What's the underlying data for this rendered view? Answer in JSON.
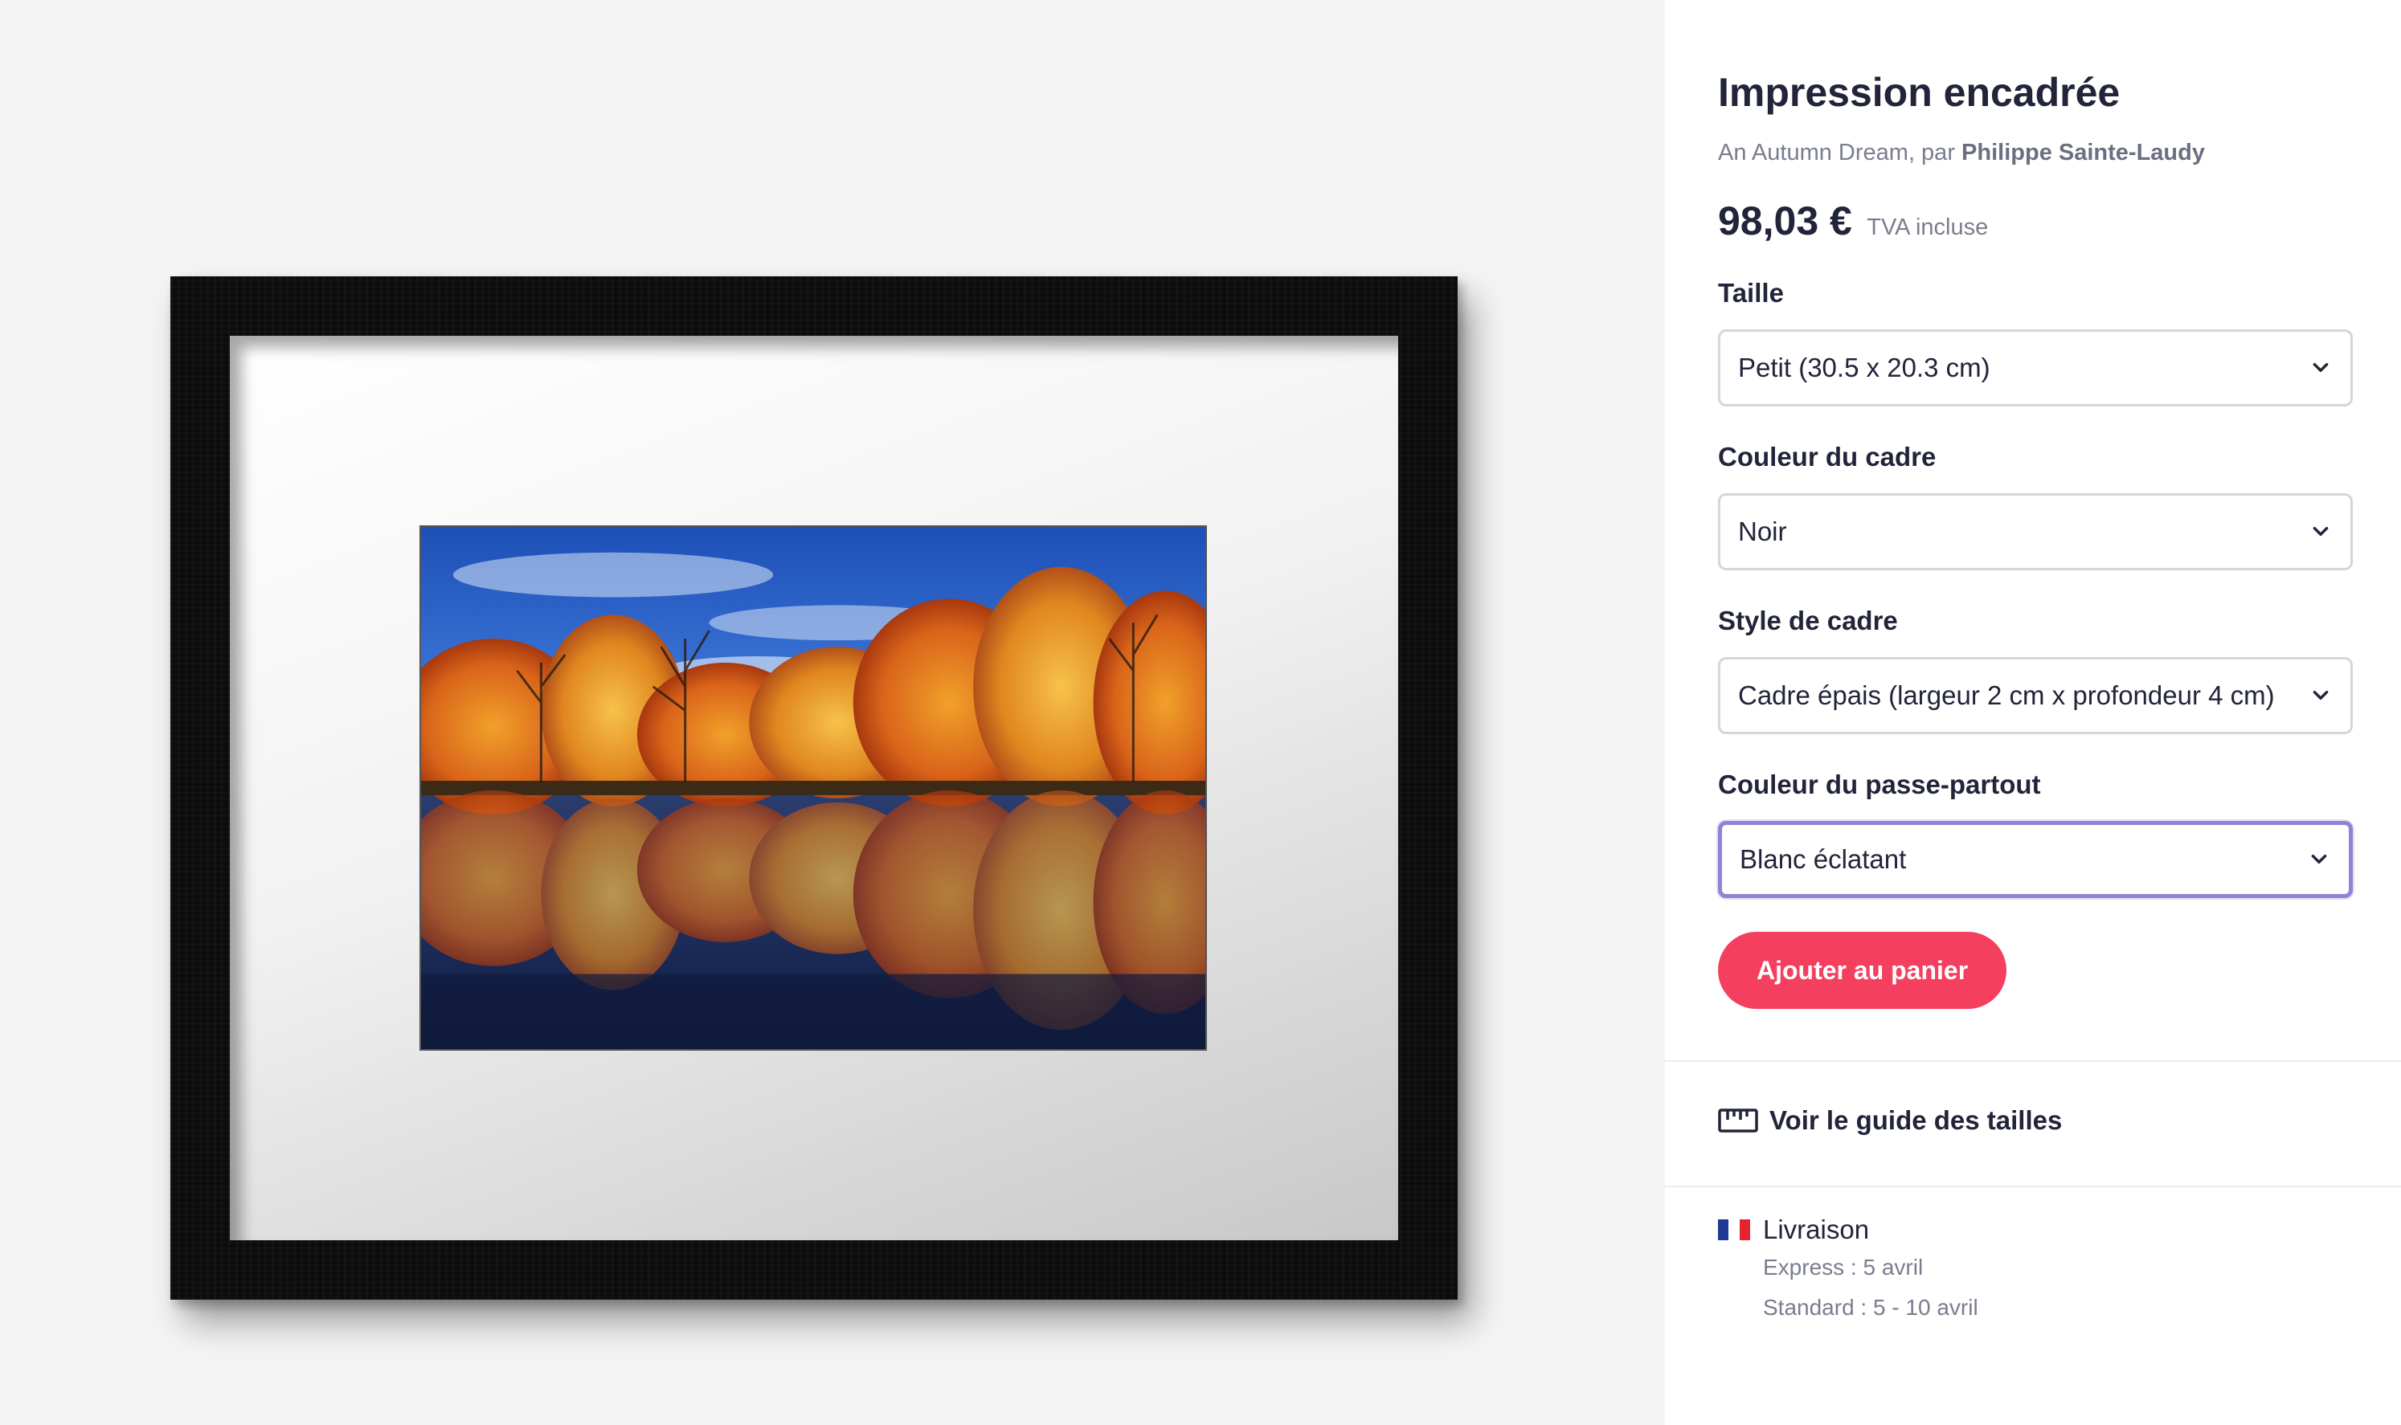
{
  "product": {
    "title": "Impression encadrée",
    "byline_prefix": "An Autumn Dream, par",
    "artist": "Philippe Sainte-Laudy",
    "price": "98,03 €",
    "tax_note": "TVA incluse"
  },
  "options": [
    {
      "label": "Taille",
      "value": "Petit (30.5 x 20.3 cm)"
    },
    {
      "label": "Couleur du cadre",
      "value": "Noir"
    },
    {
      "label": "Style de cadre",
      "value": "Cadre épais (largeur 2 cm x profondeur 4 cm)"
    },
    {
      "label": "Couleur du passe-partout",
      "value": "Blanc éclatant"
    }
  ],
  "actions": {
    "add_to_cart": "Ajouter au panier",
    "size_guide": "Voir le guide des tailles"
  },
  "shipping": {
    "title": "Livraison",
    "express": "Express : 5 avril",
    "standard": "Standard : 5 - 10 avril"
  },
  "colors": {
    "accent": "#f43f5e",
    "focus_ring": "#8f83d6",
    "frame": "#0c0c0c",
    "flag_blue": "#1f3a93",
    "flag_white": "#ffffff",
    "flag_red": "#e4252f"
  },
  "icons": {
    "select_chevron": "chevron-down-icon",
    "size_guide": "ruler-icon",
    "country": "flag-france-icon"
  }
}
